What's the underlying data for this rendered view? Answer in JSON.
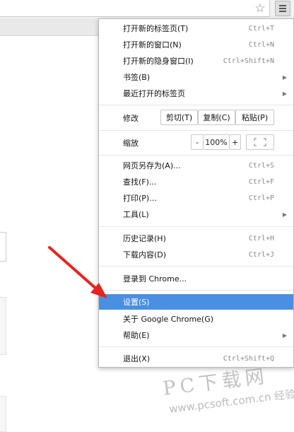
{
  "toolbar": {
    "bookmark_icon": "star-outline-icon",
    "menu_icon": "hamburger-menu-icon"
  },
  "menu": {
    "items_top": [
      {
        "label": "打开新的标签页(T)",
        "shortcut": "Ctrl+T"
      },
      {
        "label": "打开新的窗口(N)",
        "shortcut": "Ctrl+N"
      },
      {
        "label": "打开新的隐身窗口(I)",
        "shortcut": "Ctrl+Shift+N"
      },
      {
        "label": "书签(B)",
        "has_submenu": true
      },
      {
        "label": "最近打开的标签页",
        "has_submenu": true
      }
    ],
    "edit": {
      "label": "修改",
      "cut": "剪切(T)",
      "copy": "复制(C)",
      "paste": "粘贴(P)"
    },
    "zoom": {
      "label": "缩放",
      "minus": "-",
      "value": "100%",
      "plus": "+",
      "fullscreen_icon": "fullscreen-icon"
    },
    "items_tools": [
      {
        "label": "网页另存为(A)...",
        "shortcut": "Ctrl+S"
      },
      {
        "label": "查找(F)...",
        "shortcut": "Ctrl+F"
      },
      {
        "label": "打印(P)...",
        "shortcut": "Ctrl+P"
      },
      {
        "label": "工具(L)",
        "has_submenu": true
      }
    ],
    "items_history": [
      {
        "label": "历史记录(H)",
        "shortcut": "Ctrl+H"
      },
      {
        "label": "下载内容(D)",
        "shortcut": "Ctrl+J"
      }
    ],
    "signin": {
      "label": "登录到 Chrome..."
    },
    "items_settings": [
      {
        "label": "设置(S)",
        "highlighted": true
      },
      {
        "label": "关于 Google Chrome(G)"
      },
      {
        "label": "帮助(E)",
        "has_submenu": true
      }
    ],
    "exit": {
      "label": "退出(X)",
      "shortcut": "Ctrl+Shift+Q"
    }
  },
  "watermark": {
    "brand": "PC下载网",
    "url": "www.pcsoft.com.cn",
    "overlay": "经验"
  },
  "colors": {
    "highlight": "#4a90e2",
    "annotation_arrow": "#e8231d"
  }
}
